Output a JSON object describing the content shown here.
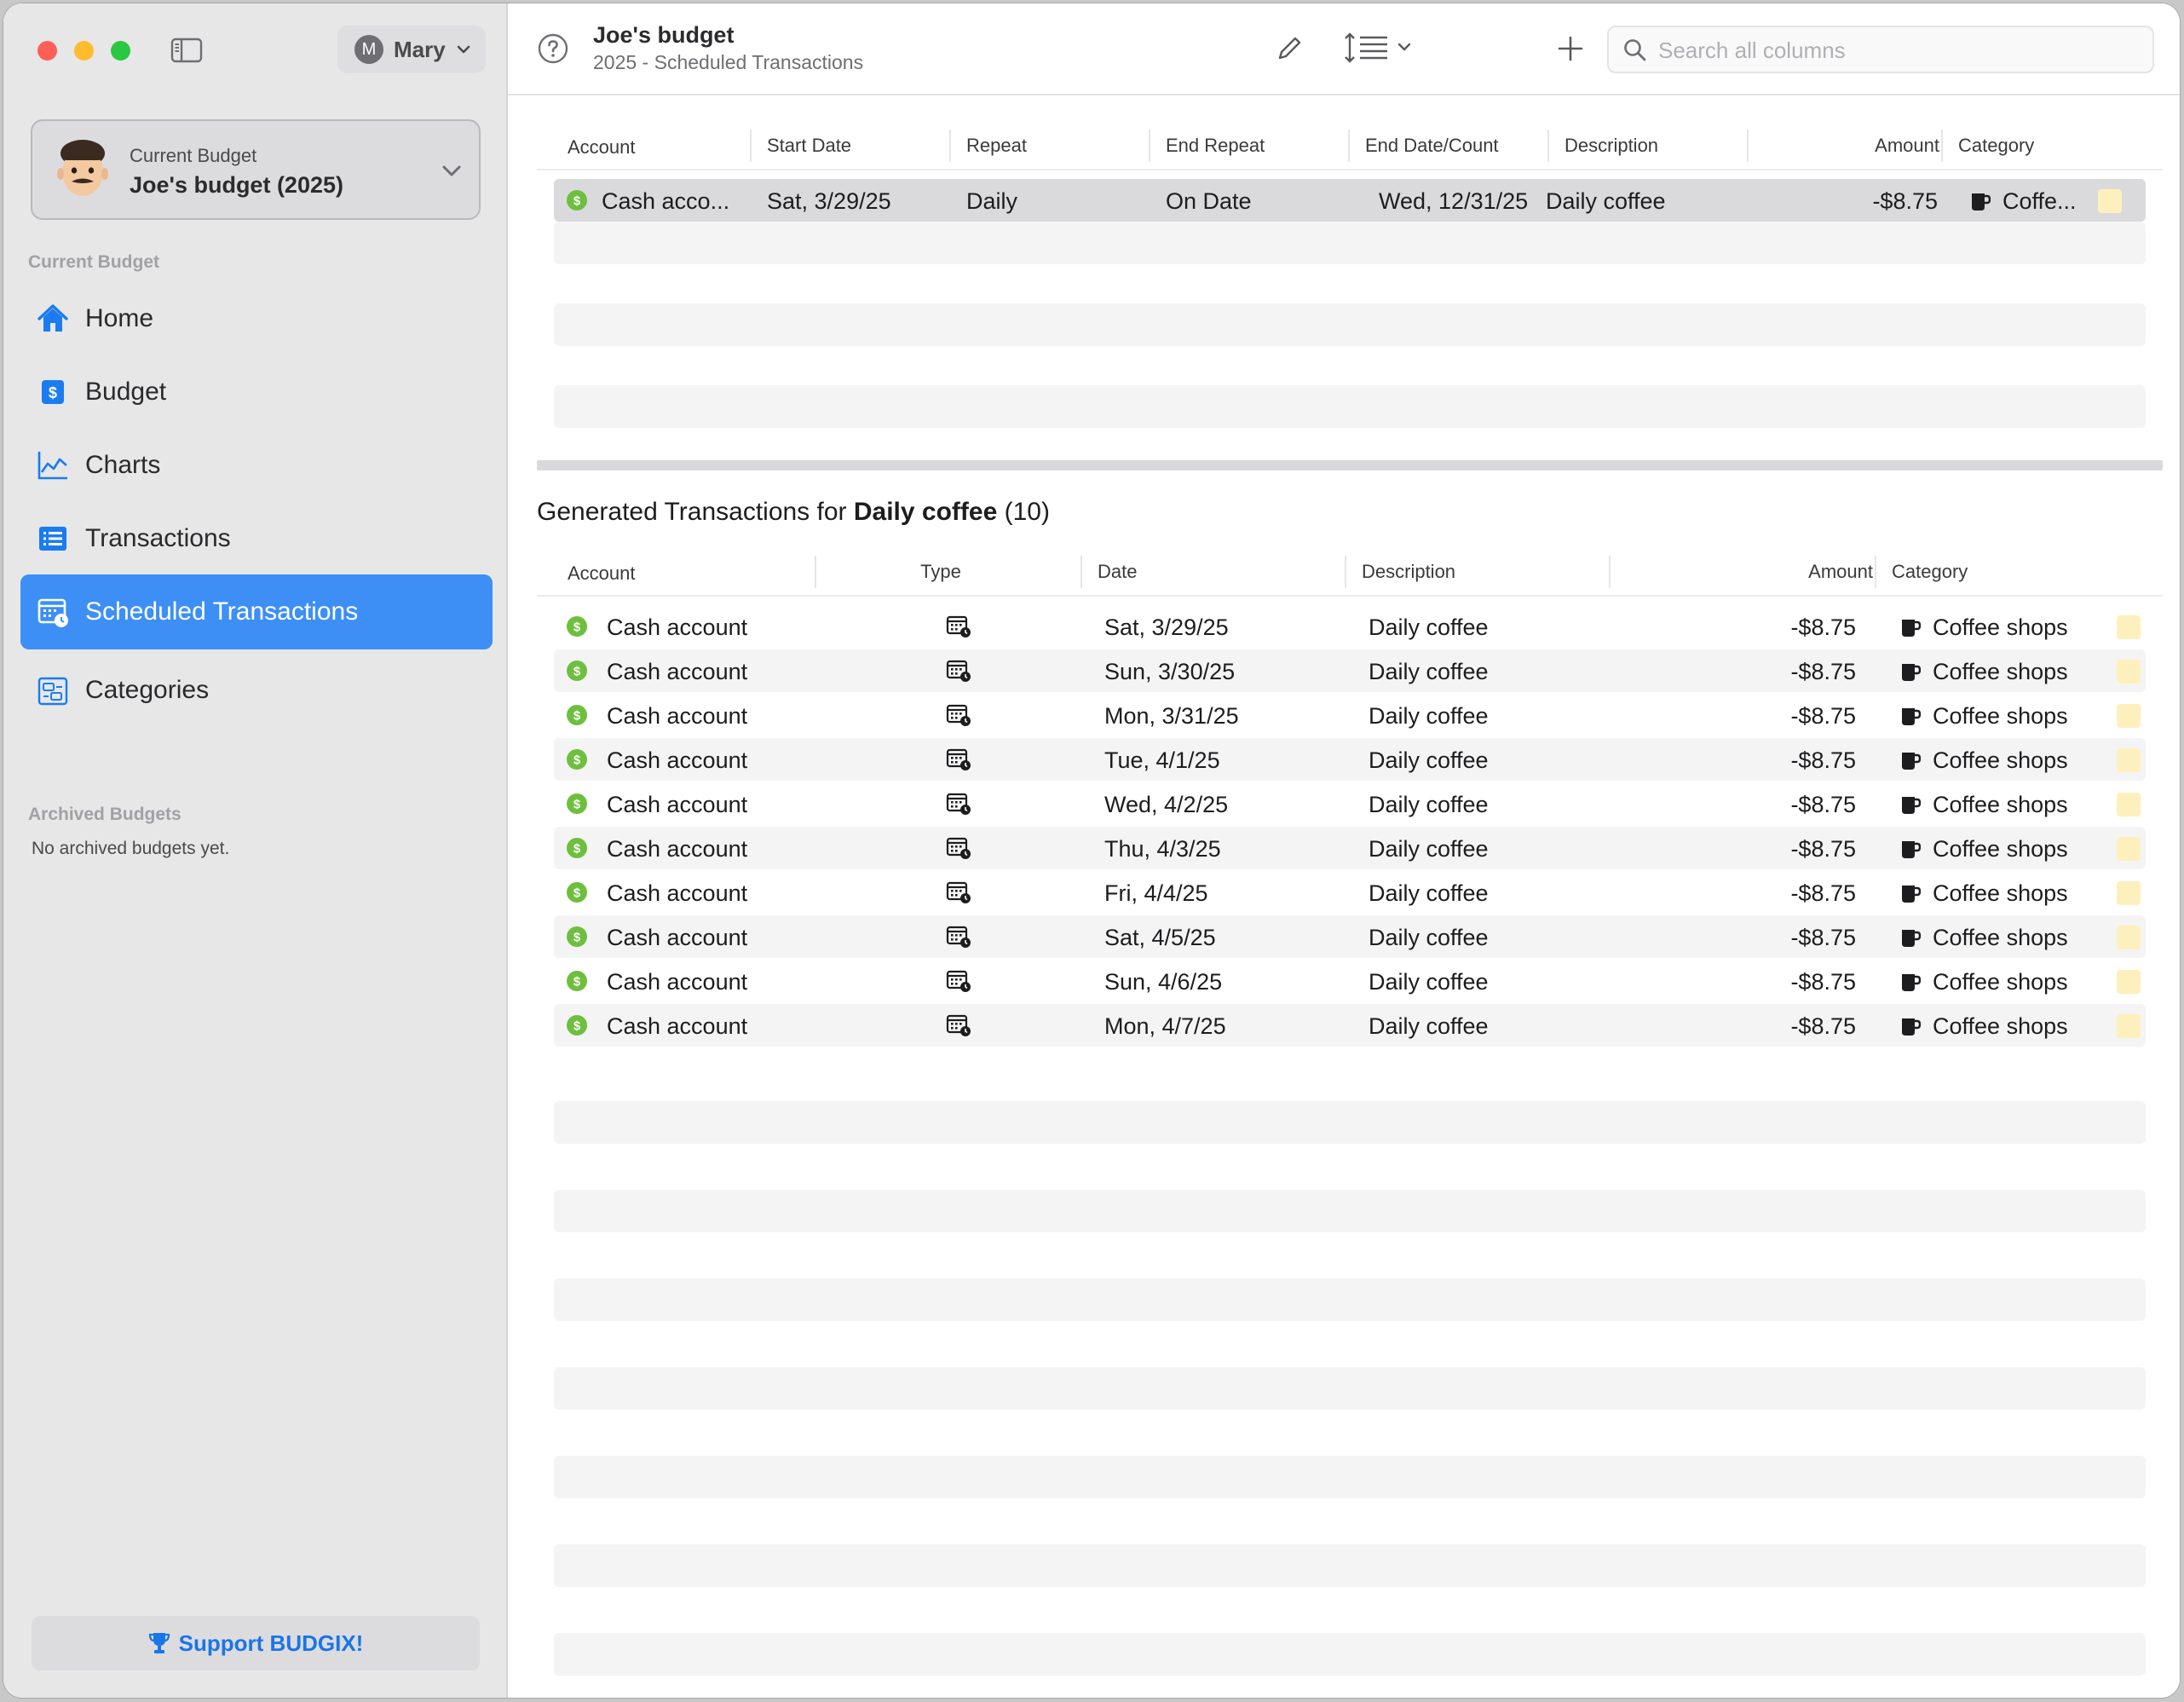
{
  "user": {
    "initial": "M",
    "name": "Mary"
  },
  "budget_card": {
    "label": "Current Budget",
    "name": "Joe's budget (2025)"
  },
  "sidebar": {
    "section_current": "Current Budget",
    "items": [
      {
        "label": "Home",
        "icon": "home-icon"
      },
      {
        "label": "Budget",
        "icon": "dollar-square-icon"
      },
      {
        "label": "Charts",
        "icon": "line-chart-icon"
      },
      {
        "label": "Transactions",
        "icon": "list-icon"
      },
      {
        "label": "Scheduled Transactions",
        "icon": "calendar-clock-icon",
        "active": true
      },
      {
        "label": "Categories",
        "icon": "categories-icon"
      }
    ],
    "section_archived": "Archived Budgets",
    "no_archived": "No archived budgets yet.",
    "support": "Support BUDGIX!"
  },
  "toolbar": {
    "title": "Joe's budget",
    "subtitle": "2025 - Scheduled Transactions",
    "search_placeholder": "Search all columns"
  },
  "scheduled": {
    "columns": [
      "Account",
      "Start Date",
      "Repeat",
      "End Repeat",
      "End Date/Count",
      "Description",
      "Amount",
      "Category"
    ],
    "rows": [
      {
        "account": "Cash acco...",
        "start_date": "Sat, 3/29/25",
        "repeat": "Daily",
        "end_repeat": "On Date",
        "end_date": "Wed, 12/31/25",
        "description": "Daily coffee",
        "amount": "-$8.75",
        "category": "Coffe..."
      }
    ]
  },
  "generated": {
    "title_prefix": "Generated Transactions for",
    "title_name": "Daily coffee",
    "title_count": "(10)",
    "columns": [
      "Account",
      "Type",
      "Date",
      "Description",
      "Amount",
      "Category"
    ],
    "rows": [
      {
        "account": "Cash account",
        "date": "Sat, 3/29/25",
        "description": "Daily coffee",
        "amount": "-$8.75",
        "category": "Coffee shops"
      },
      {
        "account": "Cash account",
        "date": "Sun, 3/30/25",
        "description": "Daily coffee",
        "amount": "-$8.75",
        "category": "Coffee shops"
      },
      {
        "account": "Cash account",
        "date": "Mon, 3/31/25",
        "description": "Daily coffee",
        "amount": "-$8.75",
        "category": "Coffee shops"
      },
      {
        "account": "Cash account",
        "date": "Tue, 4/1/25",
        "description": "Daily coffee",
        "amount": "-$8.75",
        "category": "Coffee shops"
      },
      {
        "account": "Cash account",
        "date": "Wed, 4/2/25",
        "description": "Daily coffee",
        "amount": "-$8.75",
        "category": "Coffee shops"
      },
      {
        "account": "Cash account",
        "date": "Thu, 4/3/25",
        "description": "Daily coffee",
        "amount": "-$8.75",
        "category": "Coffee shops"
      },
      {
        "account": "Cash account",
        "date": "Fri, 4/4/25",
        "description": "Daily coffee",
        "amount": "-$8.75",
        "category": "Coffee shops"
      },
      {
        "account": "Cash account",
        "date": "Sat, 4/5/25",
        "description": "Daily coffee",
        "amount": "-$8.75",
        "category": "Coffee shops"
      },
      {
        "account": "Cash account",
        "date": "Sun, 4/6/25",
        "description": "Daily coffee",
        "amount": "-$8.75",
        "category": "Coffee shops"
      },
      {
        "account": "Cash account",
        "date": "Mon, 4/7/25",
        "description": "Daily coffee",
        "amount": "-$8.75",
        "category": "Coffee shops"
      }
    ]
  },
  "colors": {
    "accent": "#3d8ff5",
    "support_text": "#1a75e8",
    "account_icon": "#6dbf3d",
    "category_swatch": "#fdf0bc"
  }
}
